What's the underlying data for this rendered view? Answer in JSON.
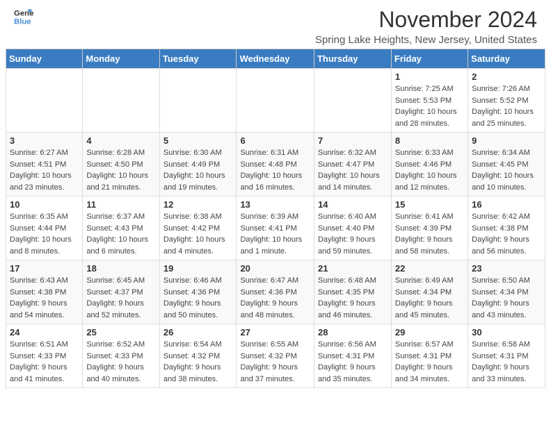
{
  "header": {
    "logo_line1": "General",
    "logo_line2": "Blue",
    "title": "November 2024",
    "subtitle": "Spring Lake Heights, New Jersey, United States"
  },
  "days_of_week": [
    "Sunday",
    "Monday",
    "Tuesday",
    "Wednesday",
    "Thursday",
    "Friday",
    "Saturday"
  ],
  "weeks": [
    [
      {
        "day": "",
        "info": ""
      },
      {
        "day": "",
        "info": ""
      },
      {
        "day": "",
        "info": ""
      },
      {
        "day": "",
        "info": ""
      },
      {
        "day": "",
        "info": ""
      },
      {
        "day": "1",
        "info": "Sunrise: 7:25 AM\nSunset: 5:53 PM\nDaylight: 10 hours and 28 minutes."
      },
      {
        "day": "2",
        "info": "Sunrise: 7:26 AM\nSunset: 5:52 PM\nDaylight: 10 hours and 25 minutes."
      }
    ],
    [
      {
        "day": "3",
        "info": "Sunrise: 6:27 AM\nSunset: 4:51 PM\nDaylight: 10 hours and 23 minutes."
      },
      {
        "day": "4",
        "info": "Sunrise: 6:28 AM\nSunset: 4:50 PM\nDaylight: 10 hours and 21 minutes."
      },
      {
        "day": "5",
        "info": "Sunrise: 6:30 AM\nSunset: 4:49 PM\nDaylight: 10 hours and 19 minutes."
      },
      {
        "day": "6",
        "info": "Sunrise: 6:31 AM\nSunset: 4:48 PM\nDaylight: 10 hours and 16 minutes."
      },
      {
        "day": "7",
        "info": "Sunrise: 6:32 AM\nSunset: 4:47 PM\nDaylight: 10 hours and 14 minutes."
      },
      {
        "day": "8",
        "info": "Sunrise: 6:33 AM\nSunset: 4:46 PM\nDaylight: 10 hours and 12 minutes."
      },
      {
        "day": "9",
        "info": "Sunrise: 6:34 AM\nSunset: 4:45 PM\nDaylight: 10 hours and 10 minutes."
      }
    ],
    [
      {
        "day": "10",
        "info": "Sunrise: 6:35 AM\nSunset: 4:44 PM\nDaylight: 10 hours and 8 minutes."
      },
      {
        "day": "11",
        "info": "Sunrise: 6:37 AM\nSunset: 4:43 PM\nDaylight: 10 hours and 6 minutes."
      },
      {
        "day": "12",
        "info": "Sunrise: 6:38 AM\nSunset: 4:42 PM\nDaylight: 10 hours and 4 minutes."
      },
      {
        "day": "13",
        "info": "Sunrise: 6:39 AM\nSunset: 4:41 PM\nDaylight: 10 hours and 1 minute."
      },
      {
        "day": "14",
        "info": "Sunrise: 6:40 AM\nSunset: 4:40 PM\nDaylight: 9 hours and 59 minutes."
      },
      {
        "day": "15",
        "info": "Sunrise: 6:41 AM\nSunset: 4:39 PM\nDaylight: 9 hours and 58 minutes."
      },
      {
        "day": "16",
        "info": "Sunrise: 6:42 AM\nSunset: 4:38 PM\nDaylight: 9 hours and 56 minutes."
      }
    ],
    [
      {
        "day": "17",
        "info": "Sunrise: 6:43 AM\nSunset: 4:38 PM\nDaylight: 9 hours and 54 minutes."
      },
      {
        "day": "18",
        "info": "Sunrise: 6:45 AM\nSunset: 4:37 PM\nDaylight: 9 hours and 52 minutes."
      },
      {
        "day": "19",
        "info": "Sunrise: 6:46 AM\nSunset: 4:36 PM\nDaylight: 9 hours and 50 minutes."
      },
      {
        "day": "20",
        "info": "Sunrise: 6:47 AM\nSunset: 4:36 PM\nDaylight: 9 hours and 48 minutes."
      },
      {
        "day": "21",
        "info": "Sunrise: 6:48 AM\nSunset: 4:35 PM\nDaylight: 9 hours and 46 minutes."
      },
      {
        "day": "22",
        "info": "Sunrise: 6:49 AM\nSunset: 4:34 PM\nDaylight: 9 hours and 45 minutes."
      },
      {
        "day": "23",
        "info": "Sunrise: 6:50 AM\nSunset: 4:34 PM\nDaylight: 9 hours and 43 minutes."
      }
    ],
    [
      {
        "day": "24",
        "info": "Sunrise: 6:51 AM\nSunset: 4:33 PM\nDaylight: 9 hours and 41 minutes."
      },
      {
        "day": "25",
        "info": "Sunrise: 6:52 AM\nSunset: 4:33 PM\nDaylight: 9 hours and 40 minutes."
      },
      {
        "day": "26",
        "info": "Sunrise: 6:54 AM\nSunset: 4:32 PM\nDaylight: 9 hours and 38 minutes."
      },
      {
        "day": "27",
        "info": "Sunrise: 6:55 AM\nSunset: 4:32 PM\nDaylight: 9 hours and 37 minutes."
      },
      {
        "day": "28",
        "info": "Sunrise: 6:56 AM\nSunset: 4:31 PM\nDaylight: 9 hours and 35 minutes."
      },
      {
        "day": "29",
        "info": "Sunrise: 6:57 AM\nSunset: 4:31 PM\nDaylight: 9 hours and 34 minutes."
      },
      {
        "day": "30",
        "info": "Sunrise: 6:58 AM\nSunset: 4:31 PM\nDaylight: 9 hours and 33 minutes."
      }
    ]
  ]
}
